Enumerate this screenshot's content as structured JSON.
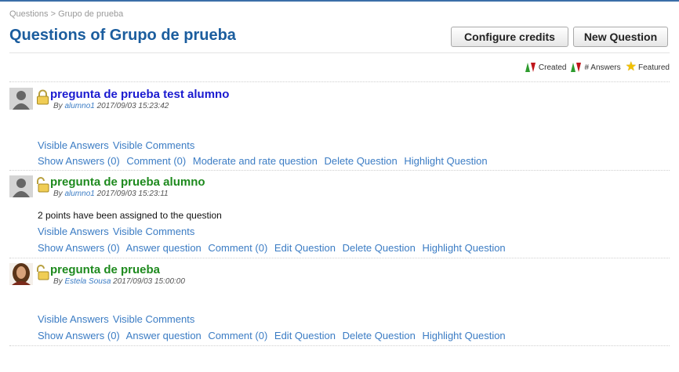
{
  "breadcrumb": "Questions > Grupo de prueba",
  "page_title": "Questions of Grupo de prueba",
  "buttons": {
    "configure_credits": "Configure credits",
    "new_question": "New Question"
  },
  "legend": {
    "created": "Created",
    "answers": "# Answers",
    "featured": "Featured"
  },
  "colors": {
    "title": "#1b5d9e",
    "link": "#3b7cc4",
    "blue_question": "#1a1ad0",
    "green_question": "#1e8a1e"
  },
  "questions": [
    {
      "title": "pregunta de prueba test alumno",
      "by_label": "By",
      "author": "alumno1",
      "date": "2017/09/03 15:23:42",
      "lock": "locked-padlock-icon",
      "info": "",
      "visible_answers": "Visible Answers",
      "visible_comments": "Visible Comments",
      "actions": [
        "Show Answers (0)",
        "Comment (0)",
        "Moderate and rate question",
        "Delete Question",
        "Highlight Question"
      ]
    },
    {
      "title": "pregunta de prueba alumno",
      "by_label": "By",
      "author": "alumno1",
      "date": "2017/09/03 15:23:11",
      "lock": "open-padlock-icon",
      "info": "2 points have been assigned to the question",
      "visible_answers": "Visible Answers",
      "visible_comments": "Visible Comments",
      "actions": [
        "Show Answers (0)",
        "Answer question",
        "Comment (0)",
        "Edit Question",
        "Delete Question",
        "Highlight Question"
      ]
    },
    {
      "title": "pregunta de prueba",
      "by_label": "By",
      "author": "Estela Sousa",
      "date": "2017/09/03 15:00:00",
      "lock": "open-padlock-icon",
      "info": "",
      "visible_answers": "Visible Answers",
      "visible_comments": "Visible Comments",
      "actions": [
        "Show Answers (0)",
        "Answer question",
        "Comment (0)",
        "Edit Question",
        "Delete Question",
        "Highlight Question"
      ]
    }
  ]
}
